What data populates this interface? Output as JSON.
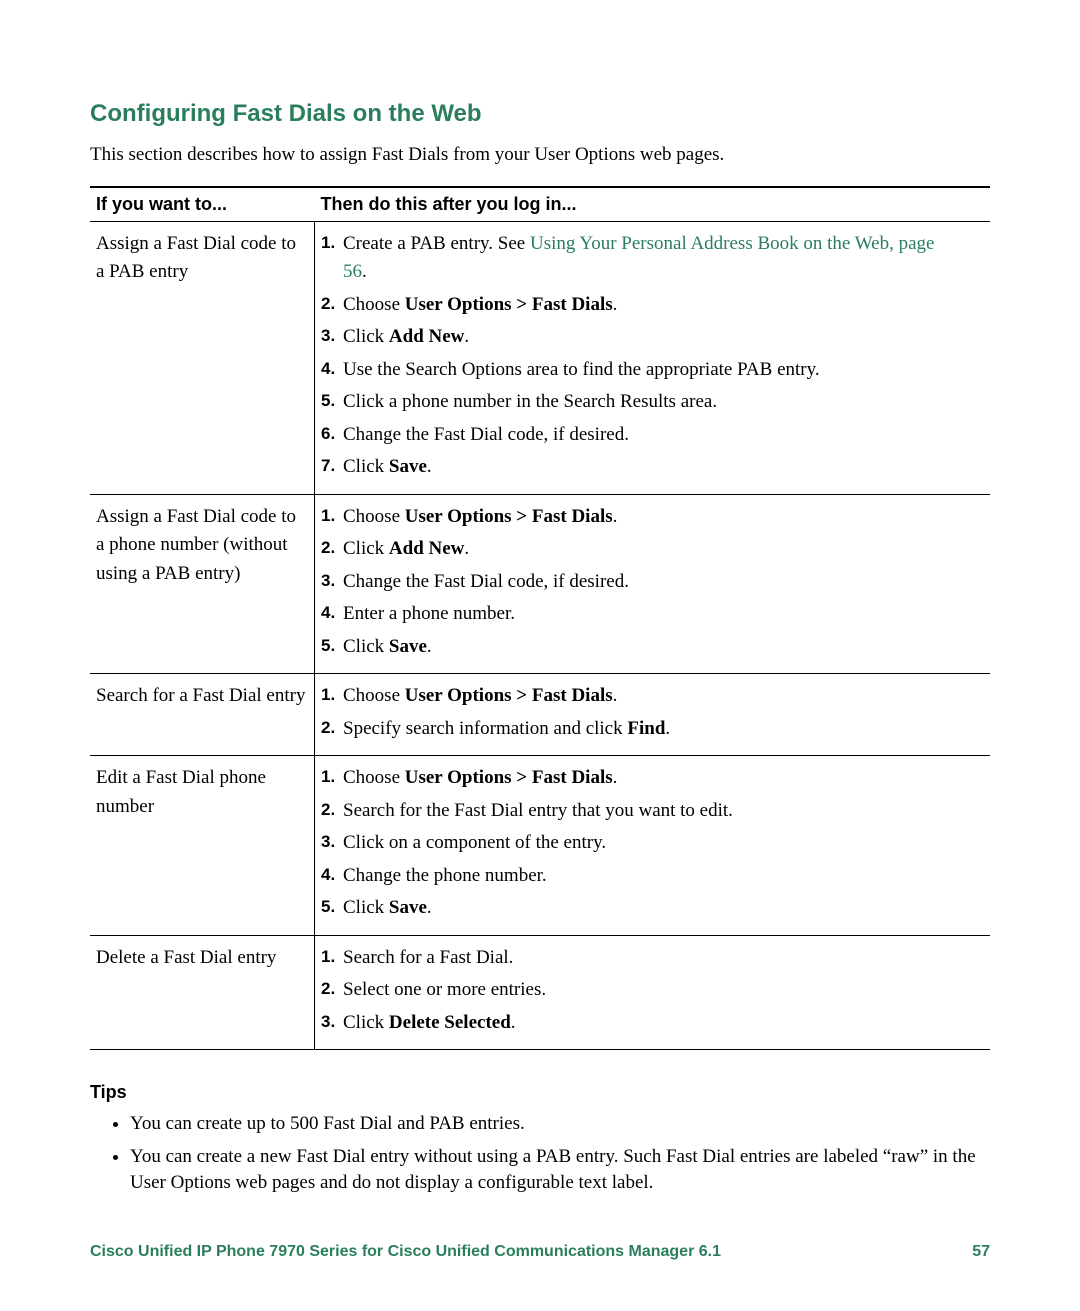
{
  "section_title": "Configuring Fast Dials on the Web",
  "intro": "This section describes how to assign Fast Dials from your User Options web pages.",
  "table": {
    "header_left": "If you want to...",
    "header_right": "Then do this after you log in...",
    "rows": [
      {
        "left": "Assign a Fast Dial code to a PAB entry",
        "steps": [
          {
            "pre": "Create a PAB entry. See ",
            "link": "Using Your Personal Address Book on the Web, page 56",
            "post": "."
          },
          {
            "pre": "Choose ",
            "bold": "User Options > Fast Dials",
            "post": "."
          },
          {
            "pre": "Click ",
            "bold": "Add New",
            "post": "."
          },
          {
            "plain": "Use the Search Options area to find the appropriate PAB entry."
          },
          {
            "plain": "Click a phone number in the Search Results area."
          },
          {
            "plain": "Change the Fast Dial code, if desired."
          },
          {
            "pre": "Click ",
            "bold": "Save",
            "post": "."
          }
        ]
      },
      {
        "left": "Assign a Fast Dial code to a phone number (without using a PAB entry)",
        "steps": [
          {
            "pre": "Choose ",
            "bold": "User Options > Fast Dials",
            "post": "."
          },
          {
            "pre": "Click ",
            "bold": "Add New",
            "post": "."
          },
          {
            "plain": "Change the Fast Dial code, if desired."
          },
          {
            "plain": "Enter a phone number."
          },
          {
            "pre": "Click ",
            "bold": "Save",
            "post": "."
          }
        ]
      },
      {
        "left": "Search for a Fast Dial entry",
        "steps": [
          {
            "pre": "Choose ",
            "bold": "User Options > Fast Dials",
            "post": "."
          },
          {
            "pre": "Specify search information and click ",
            "bold": "Find",
            "post": "."
          }
        ]
      },
      {
        "left": "Edit a Fast Dial phone number",
        "steps": [
          {
            "pre": "Choose ",
            "bold": "User Options > Fast Dials",
            "post": "."
          },
          {
            "plain": "Search for the Fast Dial entry that you want to edit."
          },
          {
            "plain": "Click on a component of the entry."
          },
          {
            "plain": "Change the phone number."
          },
          {
            "pre": "Click ",
            "bold": "Save",
            "post": "."
          }
        ]
      },
      {
        "left": "Delete a Fast Dial entry",
        "steps": [
          {
            "plain": "Search for a Fast Dial."
          },
          {
            "plain": "Select one or more entries."
          },
          {
            "pre": "Click ",
            "bold": "Delete Selected",
            "post": "."
          }
        ]
      }
    ]
  },
  "tips_heading": "Tips",
  "tips": [
    "You can create up to 500 Fast Dial and PAB entries.",
    "You can create a new Fast Dial entry without using a PAB entry. Such Fast Dial entries are labeled “raw” in the User Options web pages and do not display a configurable text label."
  ],
  "footer_left": "Cisco Unified IP Phone 7970 Series for Cisco Unified Communications Manager 6.1",
  "footer_right": "57"
}
